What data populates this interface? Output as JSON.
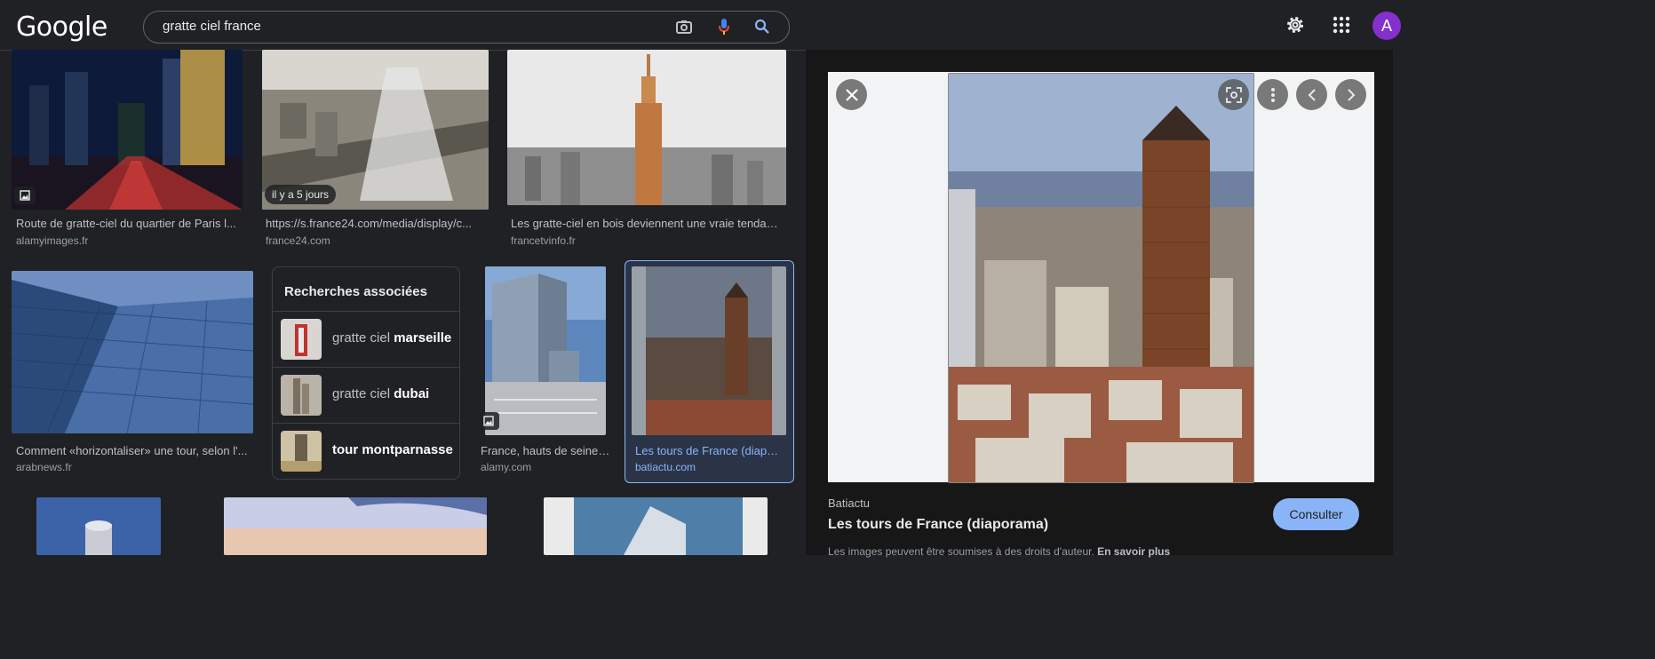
{
  "header": {
    "logo": "Google",
    "search_value": "gratte ciel france",
    "avatar_letter": "A"
  },
  "results": [
    {
      "title": "Route de gratte-ciel du quartier de Paris l...",
      "source": "alamyimages.fr"
    },
    {
      "title": "https://s.france24.com/media/display/c...",
      "source": "france24.com",
      "badge": "il y a 5 jours"
    },
    {
      "title": "Les gratte-ciel en bois deviennent une vraie tendan...",
      "source": "francetvinfo.fr"
    },
    {
      "title": "Comment «horizontaliser» une tour, selon l'...",
      "source": "arabnews.fr"
    },
    {
      "title": "France, hauts de seine, ...",
      "source": "alamy.com"
    },
    {
      "title": "Les tours de France (diapo...",
      "source": "batiactu.com"
    }
  ],
  "related": {
    "heading": "Recherches associées",
    "items": [
      {
        "prefix": "gratte ciel ",
        "bold": "marseille"
      },
      {
        "prefix": "gratte ciel ",
        "bold": "dubai"
      },
      {
        "prefix": "",
        "bold": "tour montparnasse"
      }
    ]
  },
  "preview": {
    "source": "Batiactu",
    "title": "Les tours de France (diaporama)",
    "visit_label": "Consulter",
    "notice": "Les images peuvent être soumises à des droits d'auteur.",
    "notice_link": "En savoir plus"
  },
  "colors": {
    "background": "#202124",
    "accent": "#8ab4f8",
    "avatar": "#8430ce"
  }
}
